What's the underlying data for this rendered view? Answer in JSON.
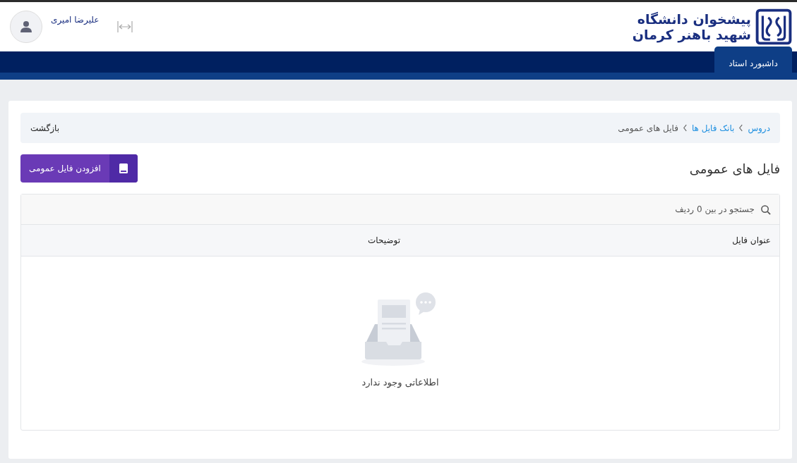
{
  "header": {
    "logo_text": [
      "پیشخوان دانشگاه",
      "شهید باهنر کرمان"
    ],
    "user_name": "علیرضا امیری"
  },
  "nav_tabs": [
    {
      "label": "داشبورد استاد",
      "selected": true
    }
  ],
  "breadcrumb": [
    {
      "label": "دروس",
      "link": true
    },
    {
      "label": "بانک فایل ها",
      "link": true
    },
    {
      "label": "فایل های عمومی",
      "link": false
    }
  ],
  "back_link": "بازگشت",
  "page_title": "فایل های عمومی",
  "add_button": "افزودن فایل عمومی",
  "search": {
    "placeholder": "جستجو در بین 0 ردیف"
  },
  "table": {
    "columns": [
      "عنوان فایل",
      "توضیحات"
    ]
  },
  "empty_message": "اطلاعاتی وجود ندارد"
}
